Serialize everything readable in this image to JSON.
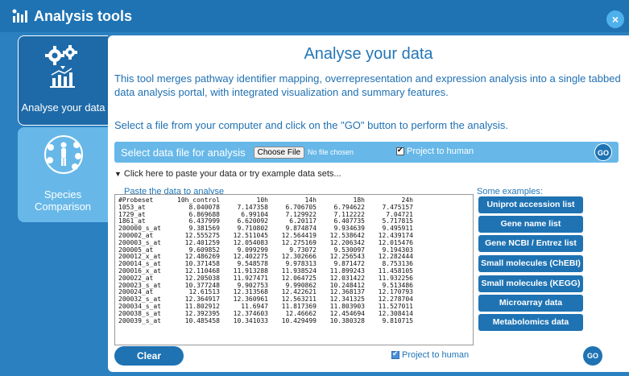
{
  "window": {
    "title": "Analysis tools",
    "close_symbol": "×"
  },
  "sidebar": {
    "tabs": [
      {
        "label": "Analyse your data",
        "icon": "gears-chart-icon",
        "active": true
      },
      {
        "label": "Species\nComparison",
        "icon": "species-icon",
        "active": false
      }
    ]
  },
  "main": {
    "title": "Analyse your data",
    "intro": "This tool merges pathway identifier mapping, overrepresentation and expression analysis into a single tabbed data analysis portal, with integrated visualization and summary features.",
    "instruction": "Select a file from your computer and click on the \"GO\" button to perform the analysis."
  },
  "filebar": {
    "label": "Select data file for analysis",
    "choose_file": "Choose File",
    "no_file": "No file chosen",
    "project_to_human": "Project to human",
    "go": "GO"
  },
  "paste": {
    "toggle": "Click here to paste your data or try example data sets...",
    "label": "Paste the data to analyse",
    "columns": [
      "#Probeset",
      "10h_control",
      "10h",
      "14h",
      "18h",
      "24h"
    ],
    "rows": [
      [
        "1053_at",
        "8.040078",
        "7.147358",
        "6.706705",
        "6.794622",
        "7.475157"
      ],
      [
        "1729_at",
        "6.869688",
        "6.99104",
        "7.129922",
        "7.112222",
        "7.04721"
      ],
      [
        "1861_at",
        "6.437999",
        "6.620092",
        "6.20117",
        "6.407735",
        "5.717815"
      ],
      [
        "200000_s_at",
        "9.381569",
        "9.710802",
        "9.874874",
        "9.934639",
        "9.495911"
      ],
      [
        "200002_at",
        "12.555275",
        "12.511045",
        "12.564419",
        "12.538642",
        "12.439174"
      ],
      [
        "200003_s_at",
        "12.401259",
        "12.054083",
        "12.275169",
        "12.206342",
        "12.015476"
      ],
      [
        "200005_at",
        "9.609852",
        "9.099299",
        "9.73072",
        "9.530097",
        "9.194303"
      ],
      [
        "200012_x_at",
        "12.486269",
        "12.402275",
        "12.302666",
        "12.256543",
        "12.282444"
      ],
      [
        "200014_s_at",
        "10.371458",
        "9.548578",
        "9.978313",
        "9.871472",
        "8.753136"
      ],
      [
        "200016_x_at",
        "12.110468",
        "11.913288",
        "11.938524",
        "11.899243",
        "11.458105"
      ],
      [
        "200022_at",
        "12.205038",
        "11.927471",
        "12.064725",
        "12.031422",
        "11.932256"
      ],
      [
        "200023_s_at",
        "10.377248",
        "9.902753",
        "9.990862",
        "10.248412",
        "9.513486"
      ],
      [
        "200024_at",
        "12.61513",
        "12.313568",
        "12.422621",
        "12.368137",
        "12.170793"
      ],
      [
        "200032_s_at",
        "12.364917",
        "12.360961",
        "12.563211",
        "12.341325",
        "12.278704"
      ],
      [
        "200034_s_at",
        "11.802912",
        "11.6947",
        "11.817369",
        "11.803903",
        "11.527011"
      ],
      [
        "200038_s_at",
        "12.392395",
        "12.374603",
        "12.46662",
        "12.454694",
        "12.308414"
      ],
      [
        "200039_s_at",
        "10.485458",
        "10.341033",
        "10.429499",
        "10.380328",
        "9.810715"
      ]
    ]
  },
  "examples": {
    "label": "Some examples:",
    "buttons": [
      "Uniprot accession list",
      "Gene name list",
      "Gene NCBI / Entrez list",
      "Small molecules (ChEBI)",
      "Small molecules (KEGG)",
      "Microarray data",
      "Metabolomics data"
    ]
  },
  "footer": {
    "clear": "Clear",
    "project_to_human": "Project to human",
    "go": "GO"
  },
  "colors": {
    "brand_blue": "#1f73b3",
    "light_blue": "#67b8e8",
    "text_blue": "#2276b7"
  }
}
